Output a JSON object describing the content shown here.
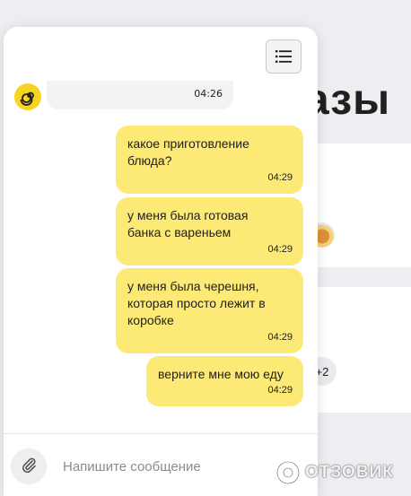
{
  "background": {
    "title_fragment": "азы",
    "badge": "+2"
  },
  "chat": {
    "incoming": {
      "time": "04:26"
    },
    "messages": [
      {
        "text": "какое приготовление\nблюда?",
        "time": "04:29"
      },
      {
        "text": "у меня была готовая\nбанка с вареньем",
        "time": "04:29"
      },
      {
        "text": "у меня была черешня,\nкоторая просто лежит в\nкоробке",
        "time": "04:29"
      },
      {
        "text": "верните мне мою еду",
        "time": "04:29"
      }
    ],
    "composer": {
      "placeholder": "Напишите сообщение"
    }
  },
  "watermark": {
    "text": "ОТЗОВИК"
  },
  "colors": {
    "bubble": "#fde975",
    "incoming_bubble": "#f2f3f5",
    "avatar_yellow": "#f7d420",
    "page_bg": "#eceef1"
  },
  "icons": {
    "menu": "hamburger-list-icon",
    "attach": "paperclip-icon",
    "avatar": "spiral-assistant-icon",
    "watermark": "otzovik-logo-icon"
  }
}
